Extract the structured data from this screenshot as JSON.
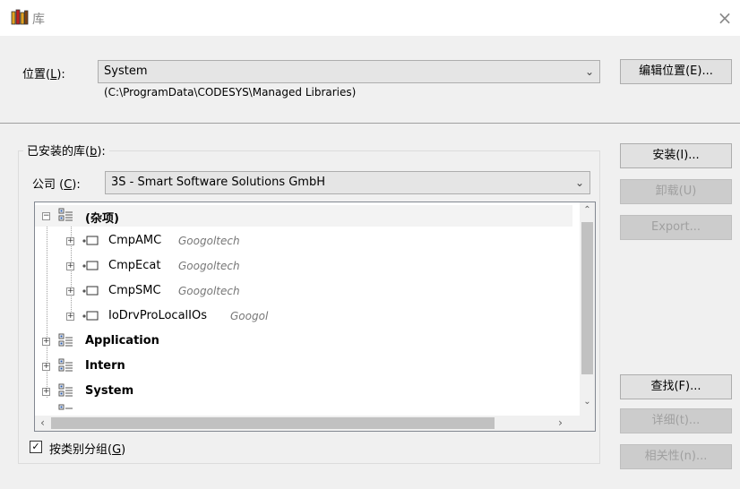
{
  "window": {
    "title": "库",
    "close_label": "×"
  },
  "location": {
    "label_text": "位置(",
    "label_key": "L",
    "label_end": "):",
    "value": "System",
    "path": "(C:\\ProgramData\\CODESYS\\Managed Libraries)",
    "edit_button": "编辑位置(E)..."
  },
  "installed": {
    "caption_text": "已安装的库(",
    "caption_key": "b",
    "caption_end": "):",
    "company_label_text": "公司 (",
    "company_label_key": "C",
    "company_label_end": "):",
    "company_value": "3S - Smart Software Solutions GmbH"
  },
  "tree": {
    "groups": [
      {
        "label": "(杂项)",
        "expanded": true
      },
      {
        "label": "Application",
        "expanded": false
      },
      {
        "label": "Intern",
        "expanded": false
      },
      {
        "label": "System",
        "expanded": false
      }
    ],
    "misc_children": [
      {
        "name": "CmpAMC",
        "company": "Googoltech"
      },
      {
        "name": "CmpEcat",
        "company": "Googoltech"
      },
      {
        "name": "CmpSMC",
        "company": "Googoltech"
      },
      {
        "name": "IoDrvProLocalIOs",
        "company": "Googol"
      }
    ]
  },
  "group_by_category": {
    "label_text": "按类别分组(",
    "label_key": "G",
    "label_end": ")",
    "checked": true
  },
  "buttons": {
    "install": "安装(I)...",
    "uninstall": "卸载(U)",
    "export": "Export...",
    "find": "查找(F)...",
    "details": "详细(t)...",
    "dependencies": "相关性(n)..."
  },
  "colors": {
    "dialog_bg": "#f0f0f0",
    "disabled_text": "#a0a0a0"
  }
}
